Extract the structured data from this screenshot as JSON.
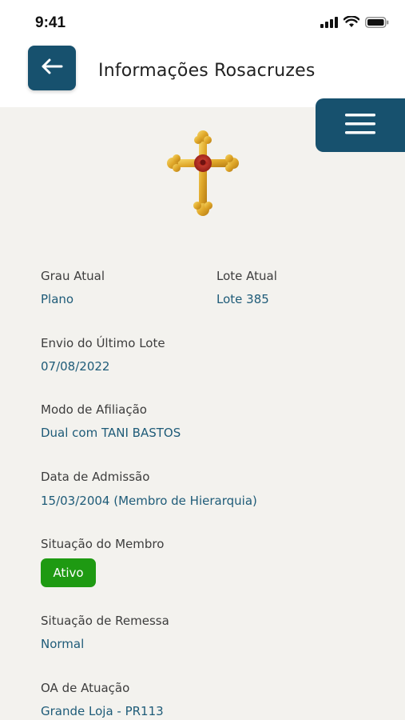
{
  "status_bar": {
    "time": "9:41",
    "icons": [
      "signal-icon",
      "wifi-icon",
      "battery-icon"
    ]
  },
  "header": {
    "title": "Informações Rosacruzes",
    "back_icon": "arrow-left-icon",
    "menu_icon": "hamburger-menu-icon"
  },
  "emblem": {
    "icon": "rosy-cross-icon"
  },
  "fields": {
    "grau_atual": {
      "label": "Grau Atual",
      "value": "Plano"
    },
    "lote_atual": {
      "label": "Lote Atual",
      "value": "Lote 385"
    },
    "envio_ultimo_lote": {
      "label": "Envio do Último Lote",
      "value": "07/08/2022"
    },
    "modo_afiliacao": {
      "label": "Modo de Afiliação",
      "value": "Dual com TANI BASTOS"
    },
    "data_admissao": {
      "label": "Data de Admissão",
      "value": "15/03/2004 (Membro de Hierarquia)"
    },
    "situacao_membro": {
      "label": "Situação do Membro",
      "value": "Ativo"
    },
    "situacao_remessa": {
      "label": "Situação de Remessa",
      "value": "Normal"
    },
    "oa_atuacao": {
      "label": "OA de Atuação",
      "value": "Grande Loja - PR113"
    }
  },
  "colors": {
    "primary": "#17516e",
    "value_text": "#1e5b78",
    "active_badge": "#1e9a12",
    "background": "#f3f2ee"
  }
}
